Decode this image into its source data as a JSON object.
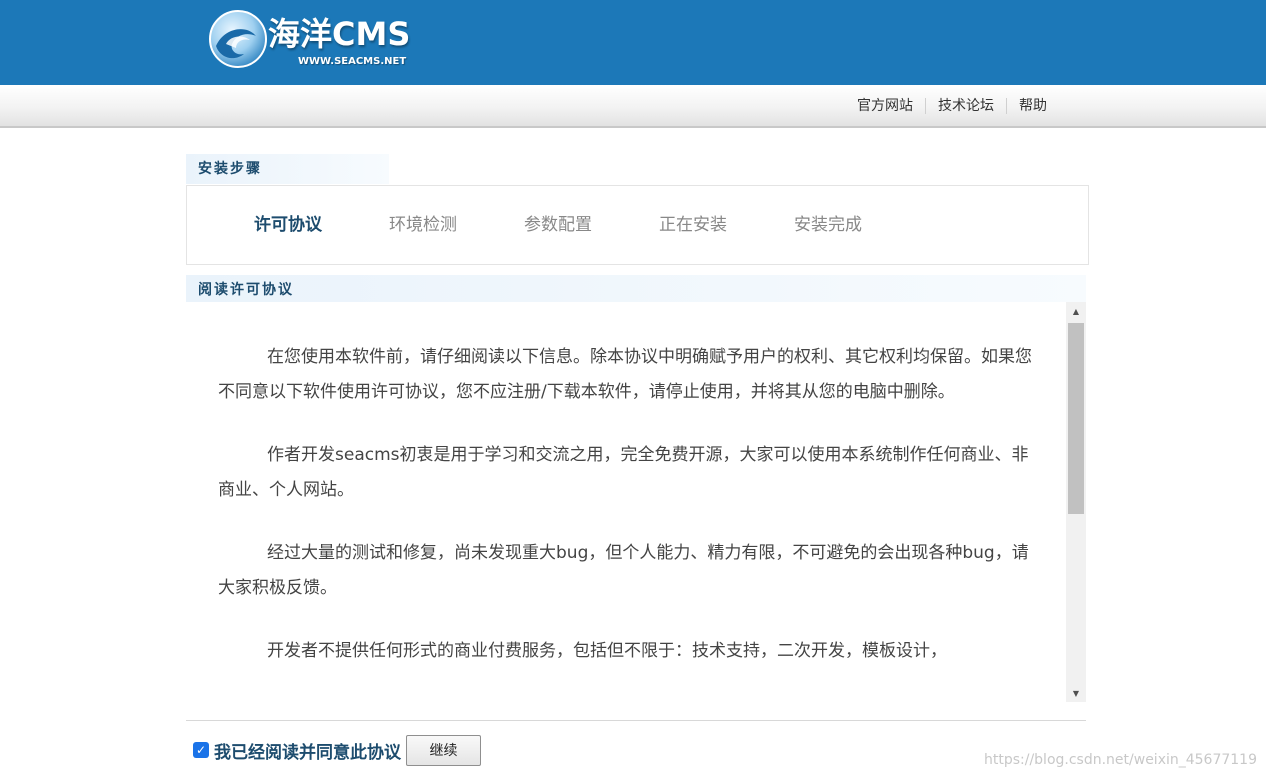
{
  "header": {
    "logo_title": "海洋CMS",
    "logo_url": "WWW.SEACMS.NET",
    "colors": {
      "bar": "#1c78b8"
    }
  },
  "nav": {
    "links": [
      {
        "label": "官方网站"
      },
      {
        "label": "技术论坛"
      },
      {
        "label": "帮助"
      }
    ]
  },
  "steps": {
    "heading": "安装步骤",
    "items": [
      {
        "label": "许可协议",
        "active": true
      },
      {
        "label": "环境检测",
        "active": false
      },
      {
        "label": "参数配置",
        "active": false
      },
      {
        "label": "正在安装",
        "active": false
      },
      {
        "label": "安装完成",
        "active": false
      }
    ]
  },
  "license": {
    "heading": "阅读许可协议",
    "paragraphs": [
      "在您使用本软件前，请仔细阅读以下信息。除本协议中明确赋予用户的权利、其它权利均保留。如果您不同意以下软件使用许可协议，您不应注册/下载本软件，请停止使用，并将其从您的电脑中删除。",
      "作者开发seacms初衷是用于学习和交流之用，完全免费开源，大家可以使用本系统制作任何商业、非商业、个人网站。",
      "经过大量的测试和修复，尚未发现重大bug，但个人能力、精力有限，不可避免的会出现各种bug，请大家积极反馈。",
      "开发者不提供任何形式的商业付费服务，包括但不限于：技术支持，二次开发，模板设计，"
    ]
  },
  "footer": {
    "agree_label": "我已经阅读并同意此协议",
    "agree_checked": true,
    "continue_label": "继续",
    "watermark": "https://blog.csdn.net/weixin_45677119"
  }
}
